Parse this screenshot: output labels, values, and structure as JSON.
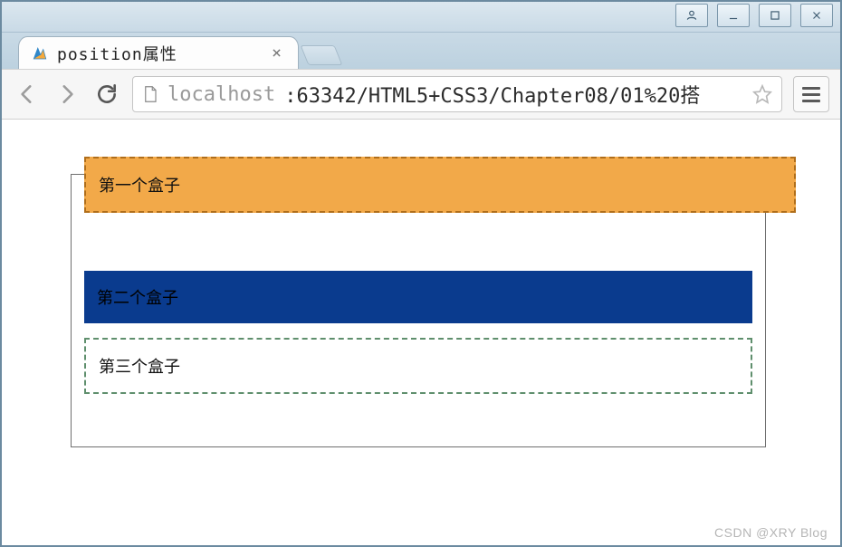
{
  "window": {
    "sysbuttons": {
      "user": "user-icon",
      "minimize": "minimize-icon",
      "maximize": "maximize-icon",
      "close": "close-icon"
    }
  },
  "tab": {
    "title": "position属性",
    "favicon": "wps-favicon"
  },
  "toolbar": {
    "url_scheme_host": "localhost",
    "url_port_path": ":63342/HTML5+CSS3/Chapter08/01%20搭"
  },
  "page": {
    "box1_label": "第一个盒子",
    "box2_label": "第二个盒子",
    "box3_label": "第三个盒子",
    "colors": {
      "box1_bg": "#f2a949",
      "box1_border": "#b06e1a",
      "box2_bg": "#0a3b8e",
      "box3_border": "#5f8f6d"
    }
  },
  "watermark": "CSDN @XRY Blog"
}
